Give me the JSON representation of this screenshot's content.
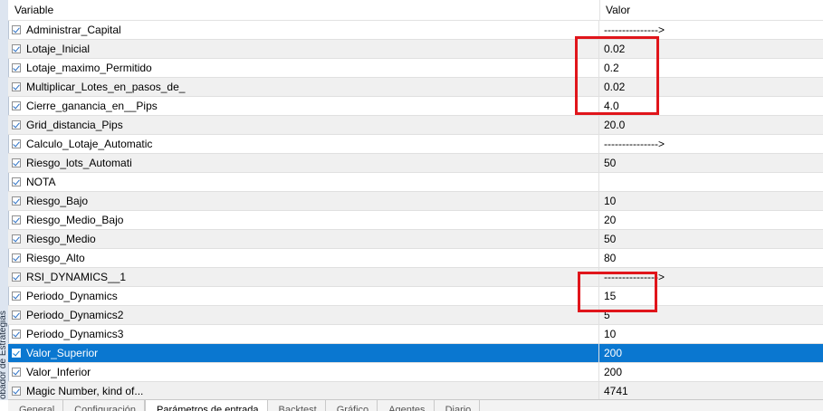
{
  "side_panel": {
    "label": "obador de Estrategias"
  },
  "columns": {
    "variable": "Variable",
    "value": "Valor"
  },
  "rows": [
    {
      "name": "Administrar_Capital",
      "value": "--------------->"
    },
    {
      "name": "Lotaje_Inicial",
      "value": "0.02"
    },
    {
      "name": "Lotaje_maximo_Permitido",
      "value": "0.2"
    },
    {
      "name": "Multiplicar_Lotes_en_pasos_de_",
      "value": "0.02"
    },
    {
      "name": "Cierre_ganancia_en__Pips",
      "value": "4.0"
    },
    {
      "name": "Grid_distancia_Pips",
      "value": "20.0"
    },
    {
      "name": "Calculo_Lotaje_Automatic",
      "value": "--------------->"
    },
    {
      "name": "Riesgo_lots_Automati",
      "value": "50"
    },
    {
      "name": "NOTA",
      "value": ""
    },
    {
      "name": "Riesgo_Bajo",
      "value": "10"
    },
    {
      "name": "Riesgo_Medio_Bajo",
      "value": "20"
    },
    {
      "name": "Riesgo_Medio",
      "value": "50"
    },
    {
      "name": "Riesgo_Alto",
      "value": "80"
    },
    {
      "name": "RSI_DYNAMICS__1",
      "value": "--------------->"
    },
    {
      "name": "Periodo_Dynamics",
      "value": "15"
    },
    {
      "name": "Periodo_Dynamics2",
      "value": "5"
    },
    {
      "name": "Periodo_Dynamics3",
      "value": "10"
    },
    {
      "name": "Valor_Superior",
      "value": "200"
    },
    {
      "name": "Valor_Inferior",
      "value": "200"
    },
    {
      "name": "Magic Number, kind of...",
      "value": "4741"
    }
  ],
  "selected_row": "Valor_Superior",
  "tabs": [
    "General",
    "Configuración",
    "Parámetros de entrada",
    "Backtest",
    "Gráfico",
    "Agentes",
    "Diario"
  ],
  "active_tab": "Parámetros de entrada",
  "colors": {
    "selection": "#0a77d0",
    "annotation": "#e0151b"
  }
}
